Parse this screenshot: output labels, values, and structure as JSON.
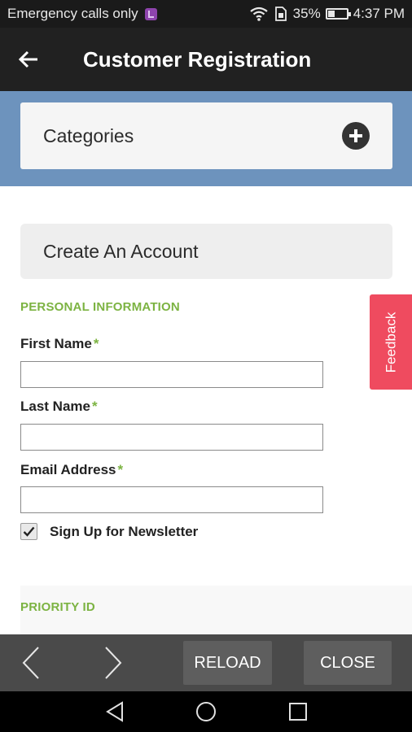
{
  "status_bar": {
    "carrier_text": "Emergency calls only",
    "battery_text": "35%",
    "battery_level": 0.35,
    "time": "4:37 PM",
    "icons": [
      "app-notification-icon",
      "wifi-icon",
      "sim-card-icon",
      "battery-icon"
    ]
  },
  "app_bar": {
    "title": "Customer Registration",
    "back_icon": "arrow-left-icon"
  },
  "categories": {
    "label": "Categories",
    "expand_icon": "plus-circle-icon"
  },
  "form": {
    "account_title": "Create An Account",
    "personal_heading": "PERSONAL INFORMATION",
    "required_marker": "*",
    "fields": [
      {
        "label": "First Name",
        "value": ""
      },
      {
        "label": "Last Name",
        "value": ""
      },
      {
        "label": "Email Address",
        "value": ""
      }
    ],
    "newsletter": {
      "label": "Sign Up for Newsletter",
      "checked": true
    },
    "priority_heading": "PRIORITY ID"
  },
  "feedback": {
    "label": "Feedback"
  },
  "toolbar": {
    "reload_label": "RELOAD",
    "close_label": "CLOSE"
  },
  "colors": {
    "app_bar": "#212121",
    "band": "#6d93bd",
    "accent_green": "#7cb342",
    "feedback": "#ef4b5f",
    "toolbar": "#4a4a4a"
  }
}
